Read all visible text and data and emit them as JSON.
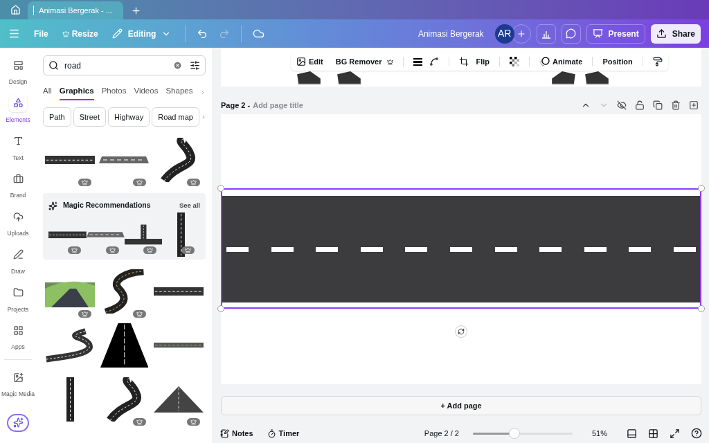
{
  "browser": {
    "tabs": [
      {
        "title": "Animasi Bergerak - ...",
        "selected": true
      }
    ]
  },
  "menubar": {
    "file": "File",
    "resize": "Resize",
    "mode": "Editing",
    "title": "Animasi Bergerak",
    "avatar": "AR",
    "present": "Present",
    "share": "Share"
  },
  "rail": [
    {
      "label": "Design",
      "selected": false
    },
    {
      "label": "Elements",
      "selected": true
    },
    {
      "label": "Text",
      "selected": false
    },
    {
      "label": "Brand",
      "selected": false
    },
    {
      "label": "Uploads",
      "selected": false
    },
    {
      "label": "Draw",
      "selected": false
    },
    {
      "label": "Projects",
      "selected": false
    },
    {
      "label": "Apps",
      "selected": false
    },
    {
      "label": "Magic Media",
      "selected": false
    }
  ],
  "search": {
    "value": "road"
  },
  "tabs": [
    {
      "label": "All",
      "selected": false
    },
    {
      "label": "Graphics",
      "selected": true
    },
    {
      "label": "Photos",
      "selected": false
    },
    {
      "label": "Videos",
      "selected": false
    },
    {
      "label": "Shapes",
      "selected": false
    }
  ],
  "chips": [
    "Path",
    "Street",
    "Highway",
    "Road map"
  ],
  "results": [
    {
      "kind": "straight",
      "premium": true
    },
    {
      "kind": "angled",
      "premium": true
    },
    {
      "kind": "curve",
      "premium": true
    }
  ],
  "magic": {
    "title": "Magic Recommendations",
    "link": "See all",
    "items": [
      {
        "kind": "straight",
        "premium": true
      },
      {
        "kind": "angled",
        "premium": true
      },
      {
        "kind": "tee",
        "premium": true
      },
      {
        "kind": "vertical",
        "premium": true
      }
    ]
  },
  "more_results": [
    {
      "kind": "scenic",
      "premium": true
    },
    {
      "kind": "winding",
      "premium": true
    },
    {
      "kind": "straight",
      "premium": false
    },
    {
      "kind": "scurve",
      "premium": false
    },
    {
      "kind": "perspective",
      "premium": false
    },
    {
      "kind": "thin",
      "premium": false
    },
    {
      "kind": "vertical",
      "premium": false
    },
    {
      "kind": "curve",
      "premium": true
    },
    {
      "kind": "horizon",
      "premium": true
    }
  ],
  "toolbar": {
    "edit": "Edit",
    "bg_remover": "BG Remover",
    "flip": "Flip",
    "animate": "Animate",
    "position": "Position"
  },
  "page": {
    "label": "Page 2 -",
    "title_placeholder": "Add page title"
  },
  "add_page": "+ Add page",
  "footer": {
    "notes": "Notes",
    "timer": "Timer",
    "page": "Page 2 / 2",
    "zoom": {
      "level": 0.42
    },
    "zoom_text": "51%"
  }
}
